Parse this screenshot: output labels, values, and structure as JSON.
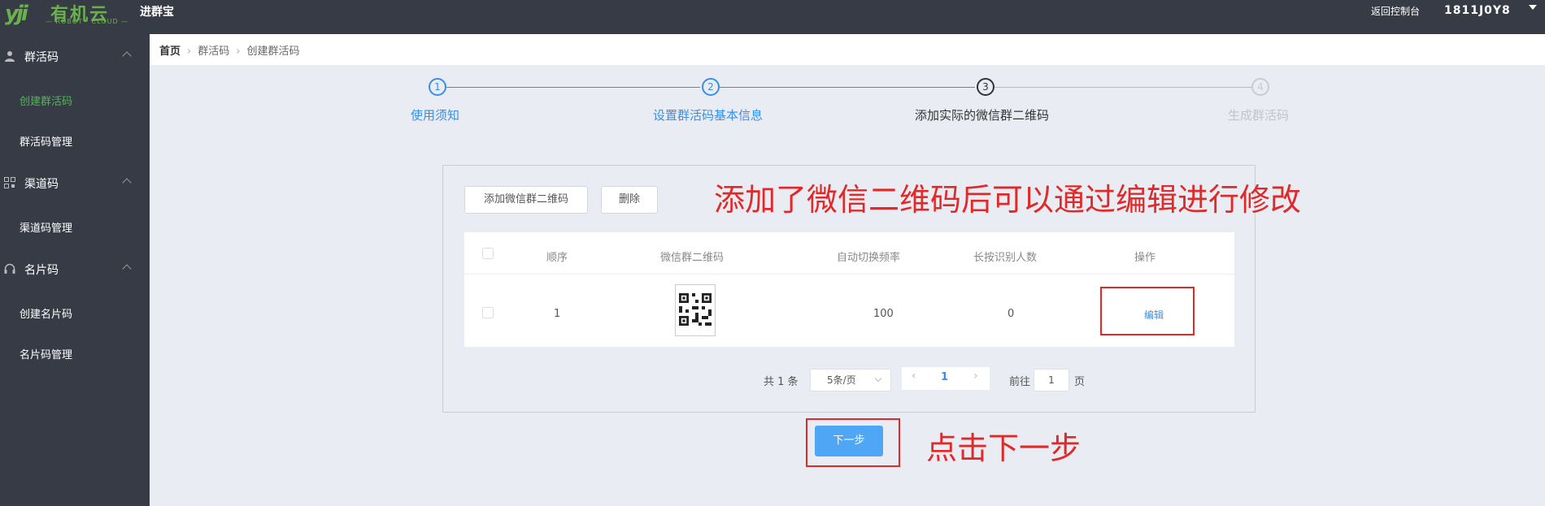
{
  "topbar": {
    "logo_mark": "yji",
    "logo_text": "有机云",
    "logo_sub": "— ROBOT · CLOUD —",
    "app_title": "进群宝",
    "back_link": "返回控制台",
    "user_name": "1811J0Y8"
  },
  "sidebar": {
    "groups": [
      {
        "label": "群活码",
        "icon": "user-icon",
        "items": [
          "创建群活码",
          "群活码管理"
        ],
        "active_item": "创建群活码"
      },
      {
        "label": "渠道码",
        "icon": "qr-grid-icon",
        "items": [
          "渠道码管理"
        ]
      },
      {
        "label": "名片码",
        "icon": "headset-icon",
        "items": [
          "创建名片码",
          "名片码管理"
        ]
      }
    ]
  },
  "breadcrumb": {
    "home": "首页",
    "level1": "群活码",
    "level2": "创建群活码"
  },
  "steps": [
    {
      "num": "1",
      "label": "使用须知",
      "state": "done"
    },
    {
      "num": "2",
      "label": "设置群活码基本信息",
      "state": "done"
    },
    {
      "num": "3",
      "label": "添加实际的微信群二维码",
      "state": "current"
    },
    {
      "num": "4",
      "label": "生成群活码",
      "state": "future"
    }
  ],
  "toolbar": {
    "add_label": "添加微信群二维码",
    "delete_label": "删除"
  },
  "table": {
    "headers": [
      "顺序",
      "微信群二维码",
      "自动切换频率",
      "长按识别人数",
      "操作"
    ],
    "rows": [
      {
        "order": "1",
        "frequency": "100",
        "scans": "0",
        "action": "编辑"
      }
    ]
  },
  "pagination": {
    "total": "共 1 条",
    "page_size": "5条/页",
    "current_page": "1",
    "goto_prefix": "前往",
    "goto_value": "1",
    "goto_suffix": "页"
  },
  "next_button": "下一步",
  "annotations": {
    "edit_note": "添加了微信二维码后可以通过编辑进行修改",
    "next_note": "点击下一步",
    "color": "#e02a2a"
  },
  "colors": {
    "primary": "#3a8ee6",
    "sidebar_bg": "#373b45",
    "active_menu": "#53b55a",
    "next_button": "#4ea6f5"
  }
}
